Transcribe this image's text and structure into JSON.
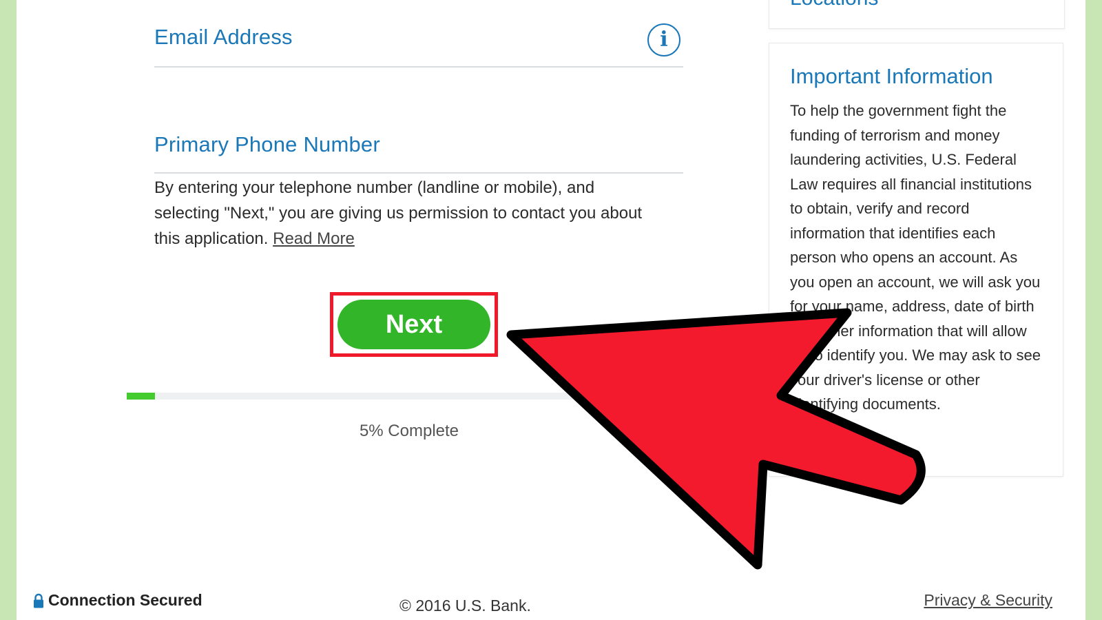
{
  "form": {
    "email_label": "Email Address",
    "phone_label": "Primary Phone Number",
    "consent_text": "By entering your telephone number (landline or mobile), and selecting \"Next,\" you are giving us permission to contact you about this application.",
    "read_more": "Read More",
    "next_label": "Next",
    "info_icon_glyph": "i"
  },
  "progress": {
    "percent": 5,
    "text": "5% Complete"
  },
  "sidebar": {
    "locations_title": "Locations",
    "info_title": "Important Information",
    "info_body": "To help the government fight the funding of terrorism and money laundering activities, U.S. Federal Law requires all financial institutions to obtain, verify and record information that identifies each person who opens an account. As you open an account, we will ask you for your name, address, date of birth and other information that will allow us to identify you. We may ask to see your driver's license or other identifying documents."
  },
  "footer": {
    "secure_text": "Connection Secured",
    "copyright": "© 2016 U.S. Bank.",
    "privacy": "Privacy & Security"
  },
  "colors": {
    "accent_blue": "#1a78b8",
    "button_green": "#33b52a",
    "progress_green": "#44cc2e",
    "highlight_red": "#f0192a",
    "page_border_green": "#c8e6b4"
  },
  "icons": {
    "info": "info-icon",
    "lock": "lock-icon",
    "arrow": "pointer-arrow-icon"
  }
}
